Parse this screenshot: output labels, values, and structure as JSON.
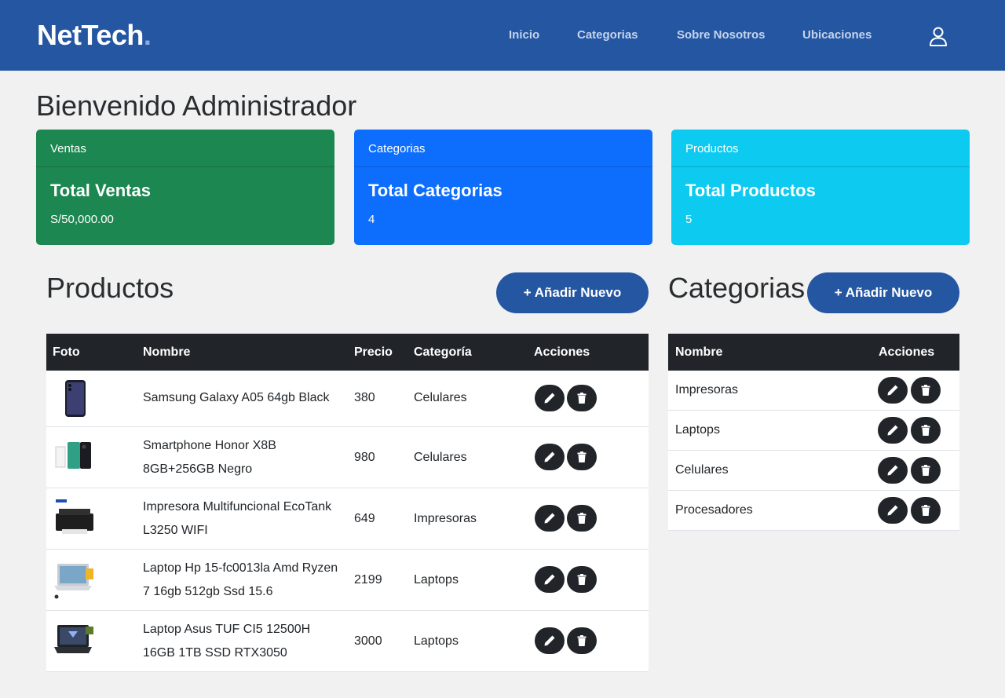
{
  "header": {
    "brand": "NetTech",
    "brand_dot": ".",
    "nav": [
      "Inicio",
      "Categorias",
      "Sobre Nosotros",
      "Ubicaciones"
    ]
  },
  "welcome": "Bienvenido Administrador",
  "cards": [
    {
      "header": "Ventas",
      "title": "Total Ventas",
      "value": "S/50,000.00"
    },
    {
      "header": "Categorias",
      "title": "Total Categorias",
      "value": "4"
    },
    {
      "header": "Productos",
      "title": "Total Productos",
      "value": "5"
    }
  ],
  "products": {
    "title": "Productos",
    "add_label": "+ Añadir Nuevo",
    "columns": [
      "Foto",
      "Nombre",
      "Precio",
      "Categoría",
      "Acciones"
    ],
    "rows": [
      {
        "name": "Samsung Galaxy A05 64gb Black",
        "price": "380",
        "category": "Celulares"
      },
      {
        "name": "Smartphone Honor X8B 8GB+256GB Negro",
        "price": "980",
        "category": "Celulares"
      },
      {
        "name": "Impresora Multifuncional EcoTank L3250 WIFI",
        "price": "649",
        "category": "Impresoras"
      },
      {
        "name": "Laptop Hp 15-fc0013la Amd Ryzen 7 16gb 512gb Ssd 15.6",
        "price": "2199",
        "category": "Laptops"
      },
      {
        "name": "Laptop Asus TUF CI5 12500H 16GB 1TB SSD RTX3050",
        "price": "3000",
        "category": "Laptops"
      }
    ]
  },
  "categories": {
    "title": "Categorias",
    "add_label": "+ Añadir Nuevo",
    "columns": [
      "Nombre",
      "Acciones"
    ],
    "rows": [
      "Impresoras",
      "Laptops",
      "Celulares",
      "Procesadores"
    ]
  },
  "colors": {
    "primary": "#2456a2",
    "success": "#1c8750",
    "blue": "#0d6efd",
    "cyan": "#0dcaf0",
    "dark": "#212529"
  },
  "icons": {
    "user": "user-icon",
    "edit": "pencil-icon",
    "delete": "trash-icon"
  }
}
